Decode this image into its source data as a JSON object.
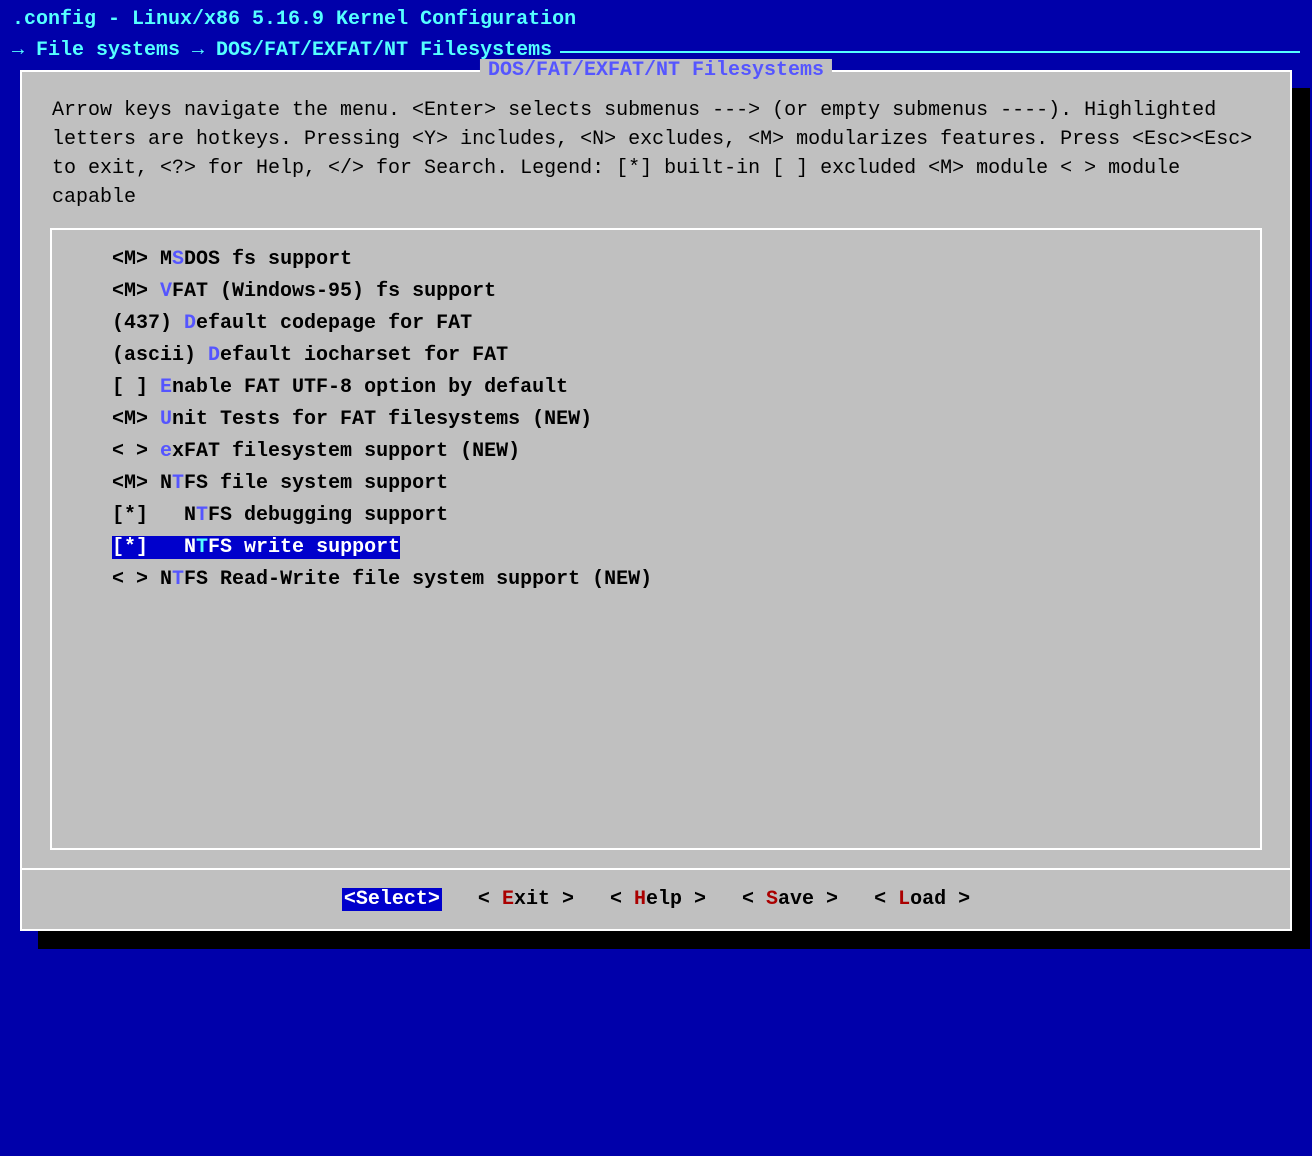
{
  "title": ".config - Linux/x86 5.16.9 Kernel Configuration",
  "breadcrumb": "→ File systems → DOS/FAT/EXFAT/NT Filesystems",
  "dialog_title": "DOS/FAT/EXFAT/NT Filesystems",
  "help_text": "Arrow keys navigate the menu.  <Enter> selects submenus ---> (or empty submenus ----).  Highlighted letters are hotkeys.  Pressing <Y> includes, <N> excludes, <M> modularizes features.  Press <Esc><Esc> to exit, <?> for Help, </> for Search.  Legend: [*] built-in  [ ] excluded  <M> module  < > module capable",
  "items": [
    {
      "prefix": "<M> ",
      "pre": "M",
      "hk": "S",
      "post": "DOS fs support",
      "selected": false
    },
    {
      "prefix": "<M> ",
      "pre": "",
      "hk": "V",
      "post": "FAT (Windows-95) fs support",
      "selected": false
    },
    {
      "prefix": "(437) ",
      "pre": "",
      "hk": "D",
      "post": "efault codepage for FAT",
      "selected": false
    },
    {
      "prefix": "(ascii) ",
      "pre": "",
      "hk": "D",
      "post": "efault iocharset for FAT",
      "selected": false
    },
    {
      "prefix": "[ ] ",
      "pre": "",
      "hk": "E",
      "post": "nable FAT UTF-8 option by default",
      "selected": false
    },
    {
      "prefix": "<M> ",
      "pre": "",
      "hk": "U",
      "post": "nit Tests for FAT filesystems (NEW)",
      "selected": false
    },
    {
      "prefix": "< > ",
      "pre": "",
      "hk": "e",
      "post": "xFAT filesystem support (NEW)",
      "selected": false
    },
    {
      "prefix": "<M> ",
      "pre": "N",
      "hk": "T",
      "post": "FS file system support",
      "selected": false
    },
    {
      "prefix": "[*]   ",
      "pre": "N",
      "hk": "T",
      "post": "FS debugging support",
      "selected": false
    },
    {
      "prefix": "[*]   ",
      "pre": "N",
      "hk": "T",
      "post": "FS write support",
      "selected": true
    },
    {
      "prefix": "< > ",
      "pre": "N",
      "hk": "T",
      "post": "FS Read-Write file system support (NEW)",
      "selected": false
    }
  ],
  "buttons": [
    {
      "pre": "<",
      "hk": "S",
      "post": "elect>",
      "active": true
    },
    {
      "pre": "< ",
      "hk": "E",
      "post": "xit >",
      "active": false
    },
    {
      "pre": "< ",
      "hk": "H",
      "post": "elp >",
      "active": false
    },
    {
      "pre": "< ",
      "hk": "S",
      "post": "ave >",
      "active": false
    },
    {
      "pre": "< ",
      "hk": "L",
      "post": "oad >",
      "active": false
    }
  ]
}
